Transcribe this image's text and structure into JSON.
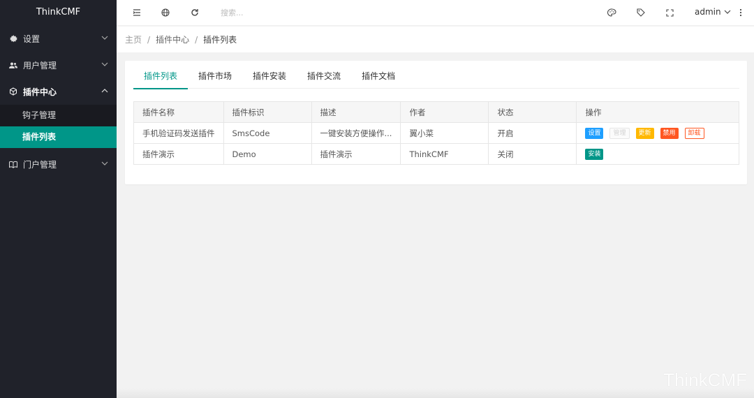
{
  "app": {
    "logo": "ThinkCMF"
  },
  "sidebar": {
    "items": [
      {
        "label": "设置",
        "icon": "gear-icon"
      },
      {
        "label": "用户管理",
        "icon": "users-icon"
      },
      {
        "label": "插件中心",
        "icon": "cube-icon"
      },
      {
        "label": "门户管理",
        "icon": "book-icon"
      }
    ],
    "subitems": [
      {
        "label": "钩子管理"
      },
      {
        "label": "插件列表"
      }
    ]
  },
  "header": {
    "search_placeholder": "搜索...",
    "user": "admin"
  },
  "breadcrumb": {
    "home": "主页",
    "section": "插件中心",
    "page": "插件列表"
  },
  "tabs": [
    "插件列表",
    "插件市场",
    "插件安装",
    "插件交流",
    "插件文档"
  ],
  "table": {
    "headers": [
      "插件名称",
      "插件标识",
      "描述",
      "作者",
      "状态",
      "操作"
    ],
    "rows": [
      {
        "name": "手机验证码发送插件",
        "id": "SmsCode",
        "desc": "一键安装方便操作...",
        "author": "翼小菜",
        "status": "开启",
        "actions": [
          "设置",
          "管理",
          "更新",
          "禁用",
          "卸载"
        ]
      },
      {
        "name": "插件演示",
        "id": "Demo",
        "desc": "插件演示",
        "author": "ThinkCMF",
        "status": "关闭",
        "actions": [
          "安装"
        ]
      }
    ]
  },
  "watermark": "ThinkCMF",
  "colors": {
    "sidebar_bg": "#20222a",
    "accent": "#009688",
    "blue": "#1e9fff",
    "orange": "#ffb800",
    "red": "#ff5722"
  }
}
